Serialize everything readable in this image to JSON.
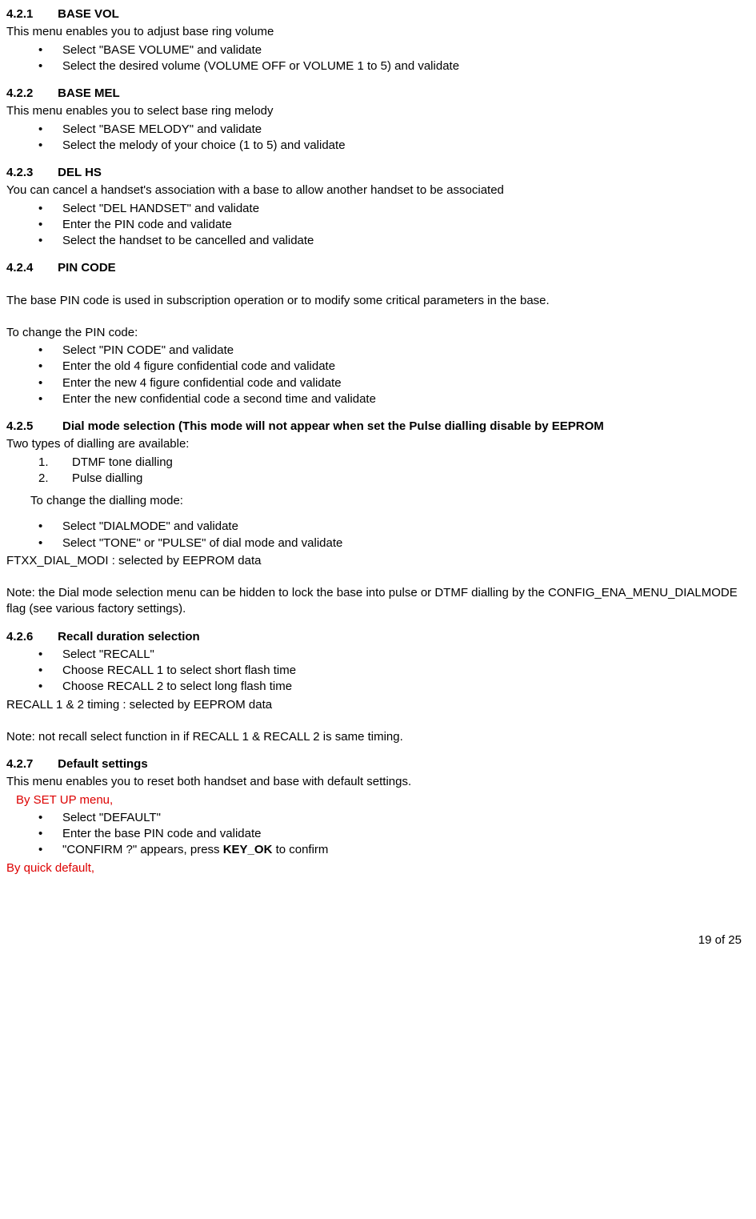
{
  "s421": {
    "num": "4.2.1",
    "title": "BASE VOL",
    "intro": "This menu enables you to adjust base ring volume",
    "b1": "Select \"BASE VOLUME\" and validate",
    "b2": "Select the desired volume (VOLUME OFF or VOLUME 1 to 5) and validate"
  },
  "s422": {
    "num": "4.2.2",
    "title": "BASE MEL",
    "intro": "This menu enables you to select base ring melody",
    "b1": "Select \"BASE MELODY\" and validate",
    "b2": "Select the melody of your choice (1 to 5) and validate"
  },
  "s423": {
    "num": "4.2.3",
    "title": "DEL HS",
    "intro": "You can cancel a handset's association with a base to allow another handset to be associated",
    "b1": "Select \"DEL HANDSET\" and validate",
    "b2": "Enter the PIN code and validate",
    "b3": "Select the handset to be cancelled and validate"
  },
  "s424": {
    "num": "4.2.4",
    "title": "PIN CODE",
    "p1": "The base PIN code is used in subscription operation or to modify some critical parameters in the base.",
    "p2": "To change the PIN code:",
    "b1": "Select \"PIN CODE\" and validate",
    "b2": "Enter the old 4 figure confidential code and validate",
    "b3": "Enter the new 4 figure confidential code and validate",
    "b4": "Enter the new confidential code a second time and validate"
  },
  "s425": {
    "num": "4.2.5",
    "title": "Dial mode selection (This mode will not appear when set the Pulse dialling disable by EEPROM",
    "intro": "Two types of dialling are available:",
    "n1": "DTMF tone dialling",
    "n2": "Pulse dialling",
    "p2": "To change the dialling mode:",
    "b1": "Select \"DIALMODE\" and validate",
    "b2": "Select \"TONE\" or \"PULSE\" of dial mode and validate",
    "p3": "FTXX_DIAL_MODI : selected by EEPROM data",
    "note": "Note: the Dial mode selection menu can be hidden to lock the base into pulse or DTMF dialling by the CONFIG_ENA_MENU_DIALMODE flag (see various factory settings)."
  },
  "s426": {
    "num": "4.2.6",
    "title": "Recall duration selection",
    "b1": "Select \"RECALL\"",
    "b2": "Choose RECALL 1 to select short flash time",
    "b3": "Choose RECALL 2 to select long flash time",
    "p1": "RECALL 1 & 2 timing : selected by EEPROM data",
    "note": "Note: not recall select function in if RECALL 1 & RECALL 2 is same timing."
  },
  "s427": {
    "num": "4.2.7",
    "title": "Default settings",
    "intro": "This menu enables you to reset both handset and base with default settings.",
    "red1": "By SET UP menu,",
    "b1": "Select \"DEFAULT\"",
    "b2": "Enter the base PIN code and validate",
    "b3a": "\"CONFIRM ?\" appears, press ",
    "b3b": "KEY_OK",
    "b3c": " to confirm",
    "red2": "By quick default,"
  },
  "page": "19 of 25"
}
